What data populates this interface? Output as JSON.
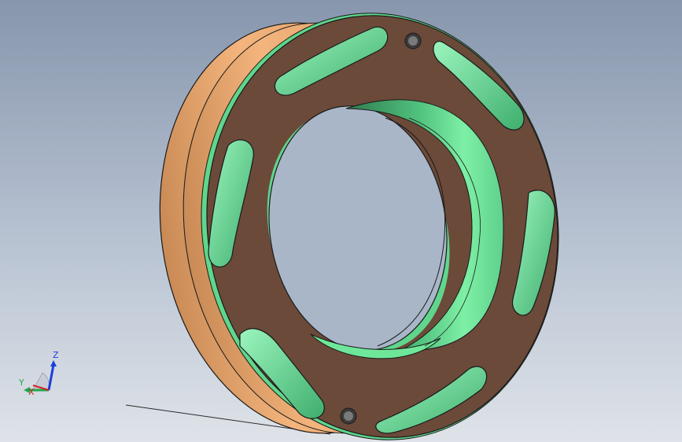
{
  "viewport": {
    "colors": {
      "background_top": "#8796ad",
      "background_bottom": "#dfe3e9",
      "part_face": "#6b4a3a",
      "part_side": "#e8a56e",
      "part_inner": "#6fe79a",
      "part_inner_dark": "#3f8f5f",
      "edge": "#1a1a1a"
    },
    "model": {
      "name": "flange-ring",
      "slots": 6,
      "bolt_holes": 2
    }
  },
  "triad": {
    "z_label": "Z",
    "y_label": "Y",
    "x_label": "X",
    "z_color": "#1d3fd8",
    "y_color": "#1fa84a",
    "x_color": "#d42323"
  }
}
